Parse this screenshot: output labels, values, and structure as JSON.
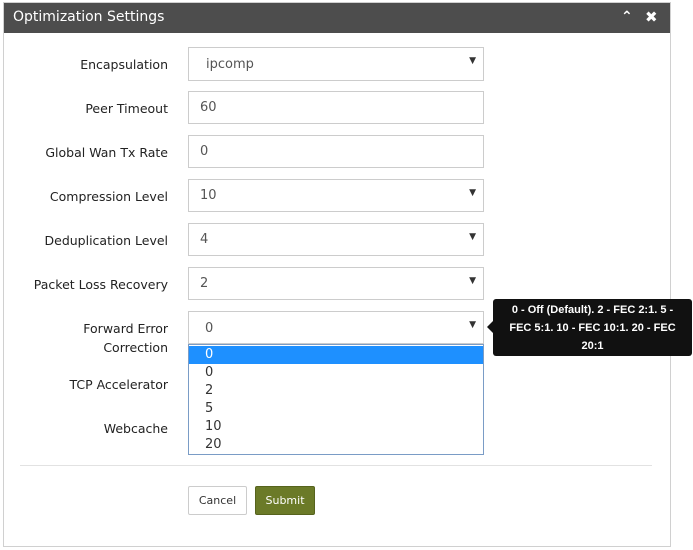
{
  "panel": {
    "title": "Optimization Settings",
    "collapse_icon": "chevron-up-icon",
    "close_icon": "close-icon"
  },
  "form": {
    "encapsulation": {
      "label": "Encapsulation",
      "value": "ipcomp"
    },
    "peer_timeout": {
      "label": "Peer Timeout",
      "value": "60"
    },
    "global_wan_tx_rate": {
      "label": "Global Wan Tx Rate",
      "value": "0"
    },
    "compression_level": {
      "label": "Compression Level",
      "value": "10"
    },
    "deduplication_level": {
      "label": "Deduplication Level",
      "value": "4"
    },
    "packet_loss_recovery": {
      "label": "Packet Loss Recovery",
      "value": "2"
    },
    "forward_error_correction": {
      "label_line1": "Forward Error",
      "label_line2": "Correction",
      "value": "0",
      "options": [
        "0",
        "0",
        "2",
        "5",
        "10",
        "20"
      ],
      "highlighted_index": 0
    },
    "tcp_accelerator": {
      "label": "TCP Accelerator"
    },
    "webcache": {
      "label": "Webcache"
    }
  },
  "tooltip": {
    "line1": "0 - Off (Default). 2 - FEC 2:1. 5 -",
    "line2": "FEC 5:1. 10 - FEC 10:1. 20 - FEC",
    "line3": "20:1"
  },
  "buttons": {
    "cancel": "Cancel",
    "submit": "Submit"
  },
  "colors": {
    "header_bg": "#4d4d4d",
    "submit_bg": "#6b7a28",
    "option_highlight": "#1e90ff",
    "tooltip_bg": "#111111"
  }
}
